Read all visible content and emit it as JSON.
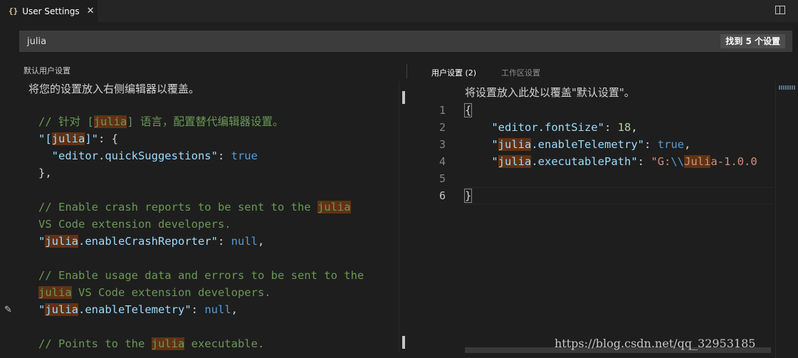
{
  "tab": {
    "icon": "{}",
    "title": "User Settings",
    "close": "✕"
  },
  "search": {
    "value": "julia",
    "count": "找到 5 个设置"
  },
  "left": {
    "title": "默认用户设置",
    "hint": "将您的设置放入右侧编辑器以覆盖。",
    "lines": [
      {
        "segs": [
          {
            "t": "// 针对 [",
            "c": "cm"
          },
          {
            "t": "julia",
            "c": "cm hl"
          },
          {
            "t": "] 语言，配置替代编辑器设置。",
            "c": "cm"
          }
        ]
      },
      {
        "segs": [
          {
            "t": "\"[",
            "c": "key"
          },
          {
            "t": "julia",
            "c": "key hl"
          },
          {
            "t": "]\"",
            "c": "key"
          },
          {
            "t": ": {",
            "c": "pn"
          }
        ]
      },
      {
        "segs": [
          {
            "t": "  \"editor.quickSuggestions\"",
            "c": "key"
          },
          {
            "t": ": ",
            "c": "pn"
          },
          {
            "t": "true",
            "c": "kw"
          }
        ]
      },
      {
        "segs": [
          {
            "t": "},",
            "c": "pn"
          }
        ]
      },
      {
        "segs": []
      },
      {
        "segs": [
          {
            "t": "// Enable crash reports to be sent to the ",
            "c": "cm"
          },
          {
            "t": "julia",
            "c": "cm hl"
          }
        ]
      },
      {
        "segs": [
          {
            "t": "VS Code extension developers.",
            "c": "cm"
          }
        ]
      },
      {
        "segs": [
          {
            "t": "\"",
            "c": "key"
          },
          {
            "t": "julia",
            "c": "key hl"
          },
          {
            "t": ".enableCrashReporter\"",
            "c": "key"
          },
          {
            "t": ": ",
            "c": "pn"
          },
          {
            "t": "null",
            "c": "kw"
          },
          {
            "t": ",",
            "c": "pn"
          }
        ]
      },
      {
        "segs": []
      },
      {
        "segs": [
          {
            "t": "// Enable usage data and errors to be sent to the",
            "c": "cm"
          }
        ]
      },
      {
        "segs": [
          {
            "t": "julia",
            "c": "cm hl"
          },
          {
            "t": " VS Code extension developers.",
            "c": "cm"
          }
        ]
      },
      {
        "segs": [
          {
            "t": "\"",
            "c": "key"
          },
          {
            "t": "julia",
            "c": "key hl"
          },
          {
            "t": ".enableTelemetry\"",
            "c": "key"
          },
          {
            "t": ": ",
            "c": "pn"
          },
          {
            "t": "null",
            "c": "kw"
          },
          {
            "t": ",",
            "c": "pn"
          }
        ]
      },
      {
        "segs": []
      },
      {
        "segs": [
          {
            "t": "// Points to the ",
            "c": "cm"
          },
          {
            "t": "julia",
            "c": "cm hl"
          },
          {
            "t": " executable.",
            "c": "cm"
          }
        ]
      }
    ]
  },
  "right": {
    "tab_user": "用户设置 (2)",
    "tab_workspace": "工作区设置",
    "hint": "将设置放入此处以覆盖\"默认设置\"。",
    "line_numbers": [
      "1",
      "2",
      "3",
      "4",
      "5",
      "6"
    ],
    "lines": [
      {
        "segs": [
          {
            "t": "{",
            "c": "pn bracket"
          }
        ]
      },
      {
        "segs": [
          {
            "t": "    \"editor.fontSize\"",
            "c": "key"
          },
          {
            "t": ": ",
            "c": "pn"
          },
          {
            "t": "18",
            "c": "num"
          },
          {
            "t": ",",
            "c": "pn"
          }
        ]
      },
      {
        "segs": [
          {
            "t": "    \"",
            "c": "key"
          },
          {
            "t": "julia",
            "c": "key hl"
          },
          {
            "t": ".enableTelemetry\"",
            "c": "key"
          },
          {
            "t": ": ",
            "c": "pn"
          },
          {
            "t": "true",
            "c": "kw"
          },
          {
            "t": ",",
            "c": "pn"
          }
        ]
      },
      {
        "segs": [
          {
            "t": "    \"",
            "c": "key"
          },
          {
            "t": "julia",
            "c": "key hl"
          },
          {
            "t": ".executablePath\"",
            "c": "key"
          },
          {
            "t": ": ",
            "c": "pn"
          },
          {
            "t": "\"G:",
            "c": "str"
          },
          {
            "t": "\\\\",
            "c": "kw"
          },
          {
            "t": "Juli",
            "c": "str hl"
          },
          {
            "t": "a-1.0.0",
            "c": "str"
          }
        ]
      },
      {
        "segs": []
      },
      {
        "segs": [
          {
            "t": "}",
            "c": "pn bracket"
          }
        ]
      }
    ]
  },
  "watermark": "https://blog.csdn.net/qq_32953185"
}
